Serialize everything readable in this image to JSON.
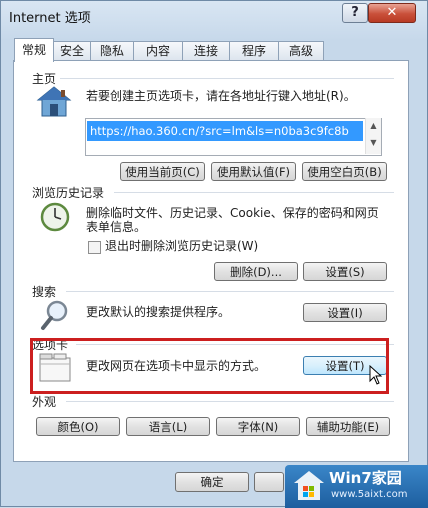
{
  "window": {
    "title": "Internet 选项",
    "help_label": "?",
    "close_label": "✕"
  },
  "tabs": [
    "常规",
    "安全",
    "隐私",
    "内容",
    "连接",
    "程序",
    "高级"
  ],
  "home": {
    "group": "主页",
    "description": "若要创建主页选项卡，请在各地址行键入地址(R)。",
    "url": "https://hao.360.cn/?src=lm&ls=n0ba3c9fc8b",
    "buttons": [
      "使用当前页(C)",
      "使用默认值(F)",
      "使用空白页(B)"
    ]
  },
  "history": {
    "group": "浏览历史记录",
    "description_line1": "删除临时文件、历史记录、Cookie、保存的密码和网页",
    "description_line2": "表单信息。",
    "checkbox_label": "退出时删除浏览历史记录(W)",
    "delete_button": "删除(D)...",
    "settings_button": "设置(S)"
  },
  "search": {
    "group": "搜索",
    "description": "更改默认的搜索提供程序。",
    "settings_button": "设置(I)"
  },
  "tabs_section": {
    "group": "选项卡",
    "description": "更改网页在选项卡中显示的方式。",
    "settings_button": "设置(T)"
  },
  "appearance": {
    "group": "外观",
    "buttons": [
      "颜色(O)",
      "语言(L)",
      "字体(N)",
      "辅助功能(E)"
    ]
  },
  "footer": {
    "ok_button": "确定"
  },
  "watermark": {
    "title": "Win7家园",
    "url": "www.5aixt.com"
  },
  "icons": [
    "house-icon",
    "clock-icon",
    "magnifier-icon",
    "tabs-page-icon",
    "cursor-icon"
  ],
  "colors": {
    "highlight": "#cc1f1f",
    "selection": "#3399ff"
  }
}
